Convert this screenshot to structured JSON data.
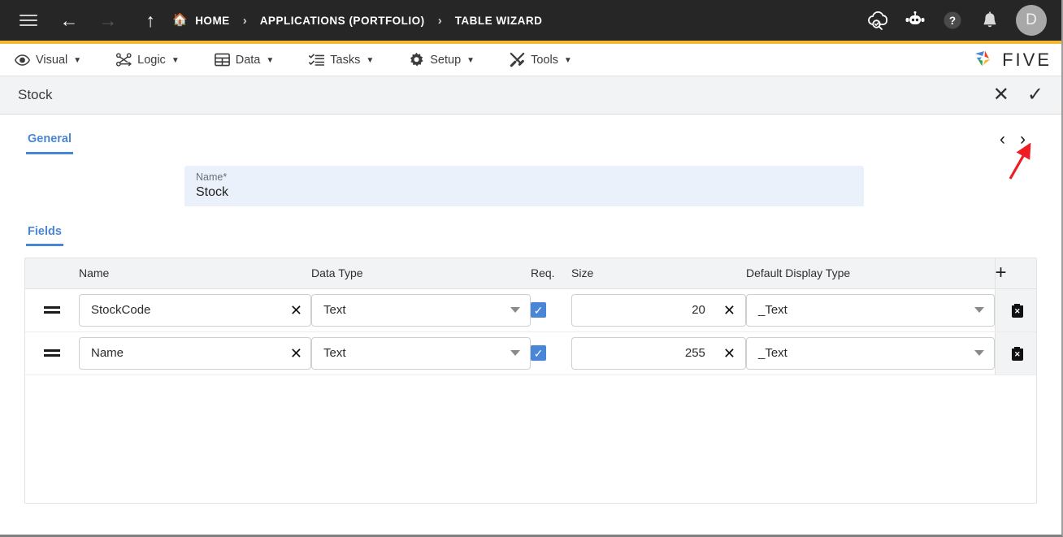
{
  "topbar": {
    "menu_icon": "hamburger-icon",
    "back_icon": "arrow-left-icon",
    "forward_icon": "arrow-right-icon",
    "up_icon": "arrow-up-icon",
    "breadcrumbs": [
      {
        "label": "HOME",
        "icon": "home-icon"
      },
      {
        "label": "APPLICATIONS (PORTFOLIO)",
        "icon": ""
      },
      {
        "label": "TABLE WIZARD",
        "icon": ""
      }
    ],
    "separator": "›",
    "right_icons": [
      "cloud-check-icon",
      "robot-icon",
      "help-icon",
      "bell-icon"
    ],
    "avatar_initial": "D"
  },
  "menubar": {
    "items": [
      {
        "label": "Visual",
        "icon": "eye-icon"
      },
      {
        "label": "Logic",
        "icon": "nodes-icon"
      },
      {
        "label": "Data",
        "icon": "table-icon"
      },
      {
        "label": "Tasks",
        "icon": "checklist-icon"
      },
      {
        "label": "Setup",
        "icon": "gear-icon"
      },
      {
        "label": "Tools",
        "icon": "tools-icon"
      }
    ],
    "caret": "▼",
    "brand": "FIVE"
  },
  "pagehead": {
    "title": "Stock",
    "cancel_label": "✕",
    "confirm_label": "✓"
  },
  "form": {
    "tab": "General",
    "prev_chevron": "‹",
    "next_chevron": "›",
    "name_label": "Name",
    "name_required_mark": "*",
    "name_value": "Stock"
  },
  "fields_section": {
    "tab": "Fields",
    "columns": [
      "Name",
      "Data Type",
      "Req.",
      "Size",
      "Default Display Type"
    ],
    "add_label": "+",
    "rows": [
      {
        "handle": "drag-handle-icon",
        "name": "StockCode",
        "name_clear": "✕",
        "data_type": "Text",
        "required": true,
        "size": "20",
        "size_clear": "✕",
        "default_display_type": "_Text",
        "delete_label": "delete-row-icon"
      },
      {
        "handle": "drag-handle-icon",
        "name": "Name",
        "name_clear": "✕",
        "data_type": "Text",
        "required": true,
        "size": "255",
        "size_clear": "✕",
        "default_display_type": "_Text",
        "delete_label": "delete-row-icon"
      }
    ]
  },
  "annotation": {
    "type": "red-arrow",
    "color": "#ee1c25",
    "points_at": "next-record-chevron"
  },
  "colors": {
    "accent_blue": "#4a86d8",
    "topbar_bg": "#262626",
    "topbar_underline": "#f5b731",
    "header_bg": "#f2f3f5",
    "field_bg": "#eaf1fb"
  }
}
